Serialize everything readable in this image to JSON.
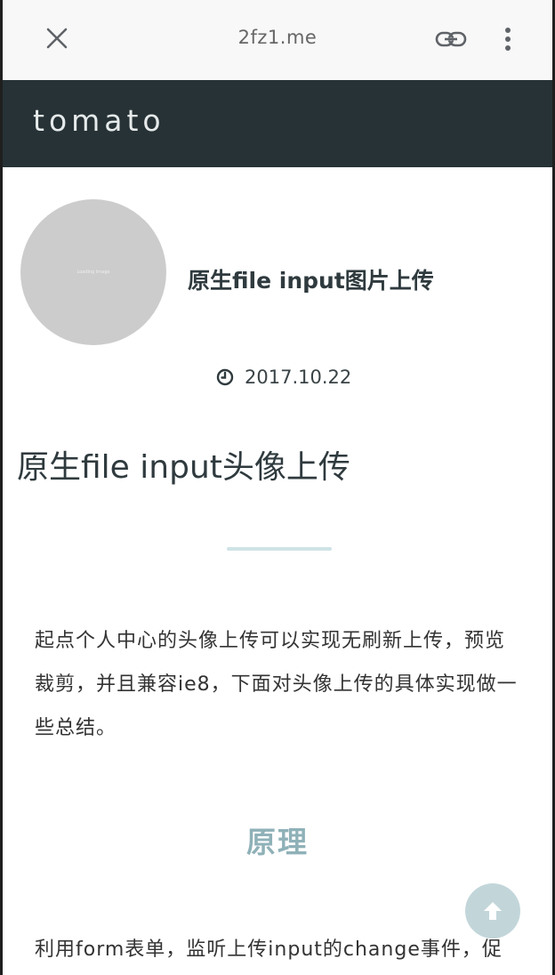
{
  "browser": {
    "url": "2fz1.me",
    "icons": {
      "close": "close-icon",
      "link": "link-icon",
      "menu": "more-vertical-icon"
    }
  },
  "site": {
    "title": "tomato"
  },
  "post": {
    "avatar_text": "Loading Image",
    "title": "原生file input图片上传",
    "date": "2017.10.22",
    "date_icon": "clock-icon"
  },
  "article": {
    "heading": "原生file input头像上传",
    "intro": "起点个人中心的头像上传可以实现无刷新上传，预览裁剪，并且兼容ie8，下面对头像上传的具体实现做一些总结。",
    "section_title": "原理",
    "section_para": "利用form表单，监听上传input的change事件，促"
  },
  "colors": {
    "header_bg": "#263236",
    "divider": "#cfe3e6",
    "section_title": "#8fb1b8",
    "back_top_bg": "#bcd2d6"
  },
  "back_to_top_icon": "arrow-up-icon"
}
